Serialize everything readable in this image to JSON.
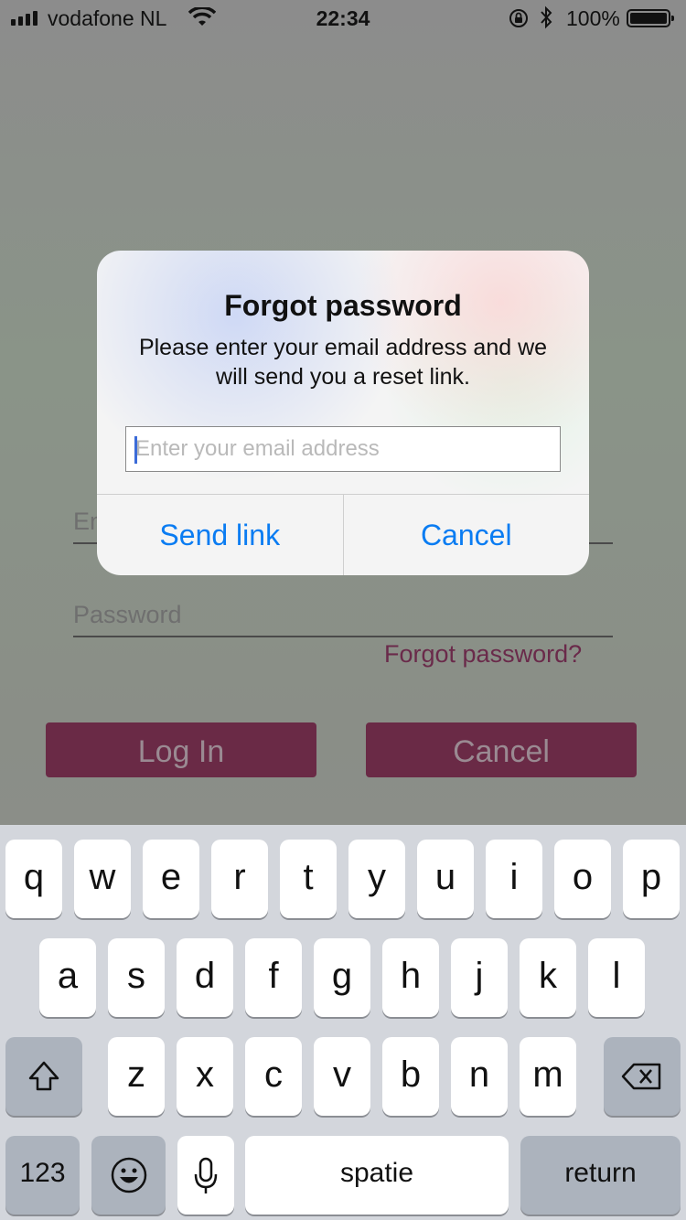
{
  "status_bar": {
    "carrier": "vodafone NL",
    "time": "22:34",
    "battery_percent": "100%",
    "icons": [
      "signal-icon",
      "wifi-icon",
      "orientation-lock-icon",
      "bluetooth-icon",
      "battery-icon"
    ]
  },
  "background_form": {
    "email_placeholder": "En",
    "password_placeholder": "Password",
    "forgot_link": "Forgot password?",
    "login_button": "Log In",
    "cancel_button": "Cancel"
  },
  "dialog": {
    "title": "Forgot password",
    "message": "Please enter your email address and we will send you a reset link.",
    "email_placeholder": "Enter your email address",
    "email_value": "",
    "send_label": "Send link",
    "cancel_label": "Cancel"
  },
  "keyboard": {
    "row1": [
      "q",
      "w",
      "e",
      "r",
      "t",
      "y",
      "u",
      "i",
      "o",
      "p"
    ],
    "row2": [
      "a",
      "s",
      "d",
      "f",
      "g",
      "h",
      "j",
      "k",
      "l"
    ],
    "row3": [
      "z",
      "x",
      "c",
      "v",
      "b",
      "n",
      "m"
    ],
    "numbers_label": "123",
    "space_label": "spatie",
    "return_label": "return"
  },
  "colors": {
    "accent": "#0a7cf2",
    "brand": "#6a2a46"
  }
}
